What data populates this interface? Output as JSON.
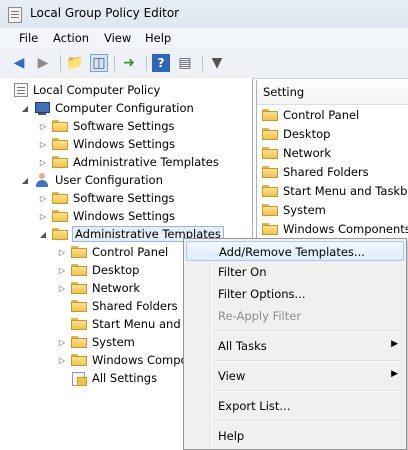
{
  "window": {
    "title": "Local Group Policy Editor"
  },
  "menubar": {
    "file": "File",
    "action": "Action",
    "view": "View",
    "help": "Help"
  },
  "tree": {
    "root": "Local Computer Policy",
    "computer_configuration": "Computer Configuration",
    "cc_software_settings": "Software Settings",
    "cc_windows_settings": "Windows Settings",
    "cc_administrative_templates": "Administrative Templates",
    "user_configuration": "User Configuration",
    "uc_software_settings": "Software Settings",
    "uc_windows_settings": "Windows Settings",
    "uc_administrative_templates": "Administrative Templates",
    "at_control_panel": "Control Panel",
    "at_desktop": "Desktop",
    "at_network": "Network",
    "at_shared_folders": "Shared Folders",
    "at_start_menu": "Start Menu and T",
    "at_system": "System",
    "at_windows_components": "Windows Compo",
    "at_all_settings": "All Settings"
  },
  "right_pane": {
    "column_header": "Setting",
    "items": [
      "Control Panel",
      "Desktop",
      "Network",
      "Shared Folders",
      "Start Menu and Taskbar",
      "System",
      "Windows Components"
    ]
  },
  "context_menu": {
    "add_remove_templates": "Add/Remove Templates...",
    "filter_on": "Filter On",
    "filter_options": "Filter Options...",
    "re_apply_filter": "Re-Apply Filter",
    "all_tasks": "All Tasks",
    "view": "View",
    "export_list": "Export List...",
    "help": "Help"
  }
}
